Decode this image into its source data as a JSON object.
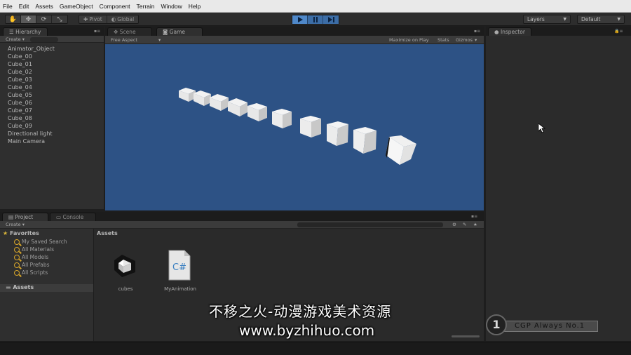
{
  "menu": [
    "File",
    "Edit",
    "Assets",
    "GameObject",
    "Component",
    "Terrain",
    "Window",
    "Help"
  ],
  "toolbar": {
    "pivot": "Pivot",
    "global": "Global",
    "layers": "Layers",
    "layout": "Default"
  },
  "hierarchy": {
    "tab": "Hierarchy",
    "create": "Create",
    "items": [
      "Animator_Object",
      "Cube_00",
      "Cube_01",
      "Cube_02",
      "Cube_03",
      "Cube_04",
      "Cube_05",
      "Cube_06",
      "Cube_07",
      "Cube_08",
      "Cube_09",
      "Directional light",
      "Main Camera"
    ]
  },
  "scene_tab": "Scene",
  "game": {
    "tab": "Game",
    "aspect": "Free Aspect",
    "maximize": "Maximize on Play",
    "stats": "Stats",
    "gizmos": "Gizmos",
    "background_color": "#2d5285"
  },
  "inspector": {
    "tab": "Inspector"
  },
  "project": {
    "tab": "Project",
    "console_tab": "Console",
    "create": "Create",
    "favorites": "Favorites",
    "favorite_items": [
      "My Saved Search",
      "All Materials",
      "All Models",
      "All Prefabs",
      "All Scripts"
    ],
    "assets_root": "Assets",
    "assets_header": "Assets",
    "assets": [
      {
        "name": "cubes",
        "icon": "unity-logo-icon"
      },
      {
        "name": "MyAnimation",
        "icon": "csharp-script-icon"
      }
    ]
  },
  "watermark": {
    "line1": "不移之火-动漫游戏美术资源",
    "line2": "www.byzhihuo.com"
  },
  "badge": {
    "number": "1",
    "text": "CGP Always No.1"
  }
}
